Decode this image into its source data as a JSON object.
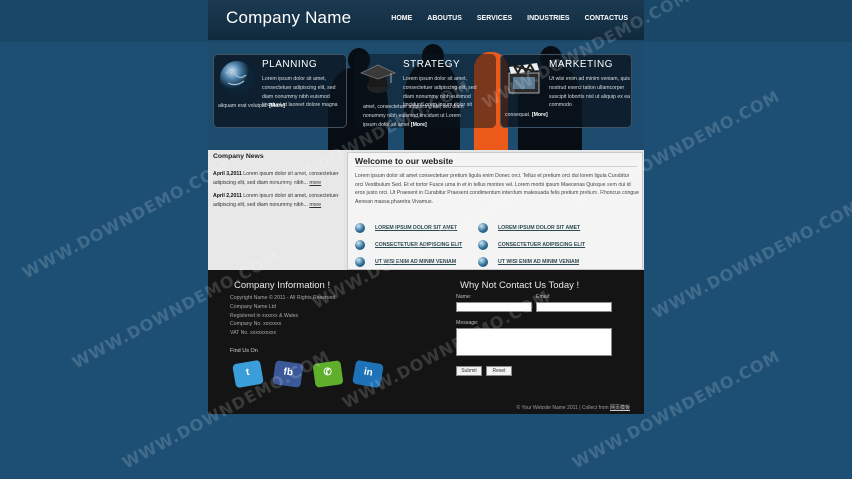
{
  "header": {
    "logo": "Company Name",
    "nav": [
      "HOME",
      "ABOUTUS",
      "SERVICES",
      "INDUSTRIES",
      "CONTACTUS"
    ]
  },
  "features": [
    {
      "title": "PLANNING",
      "icon": "globe-icon",
      "text": "Lorem ipsum dolor sit amet, consectetuer adipiscing elit, sed diam nonummy nibh euismod tincidunt ut laoreet dolore magna",
      "text2": "aliquam erat volutpat.",
      "more": "[More]"
    },
    {
      "title": "STRATEGY",
      "icon": "graduation-cap-icon",
      "text": "Lorem ipsum dolor sit amet, consectetuer adipiscing elit, sed diam nonummy nibh euismod tinciduntLorem ipsum dolor sit",
      "text2": "amet, consectetuer adipiscing elit, sed diam nonummy nibh euismod tincidunt ut Lorem ipsum dolor sit amet",
      "more": "[More]"
    },
    {
      "title": "MARKETING",
      "icon": "clapperboard-icon",
      "text": "Ut wisi enim ad minim veniam, quis nostrud exerci tation ullamcorper suscipit lobortis nisl ut aliquip ex ea commodo",
      "text2": "consequat.",
      "more": "[More]"
    }
  ],
  "news": {
    "title": "Company News",
    "items": [
      {
        "date": "April 3,2011",
        "text": "Lorem ipsum dolor sit amet, consectetuer adipiscing elit, sed diam nonummy nibh...",
        "more": "more"
      },
      {
        "date": "April 2,2011",
        "text": "Lorem ipsum dolor sit amet, consectetuer adipiscing elit, sed diam nonummy nibh...",
        "more": "more"
      }
    ]
  },
  "welcome": {
    "title": "Welcome to our website",
    "text": "Lorem ipsum dolor sit amet consectetuer pretium ligula enim Donec orci. Tellus et pretium orci dui lorem ligula Curabitur orci Vestibulum Sed. Et et tortor Fusce urna in et in tellus montes vel. Lorem morbi ipsum Maecenas Quisque sem dui id eros justo orci. Ut Praesent in Curabitur Praesent condimentum interdum malesuada felis pretium pretium. Rhoncus congue Aenean massa pharetra Vivamus.",
    "links": [
      "LOREM IPSUM DOLOR SIT AMET",
      "LOREM IPSUM DOLOR SIT AMET",
      "CONSECTETUER ADIPISCING ELIT",
      "CONSECTETUER ADIPISCING ELIT",
      "UT WISI ENIM AD MINIM VENIAM",
      "UT WISI ENIM AD MINIM VENIAM"
    ]
  },
  "footer": {
    "info_title": "Company Information !",
    "info_lines": [
      "Copyright Name © 2011 - All Rights Reserved",
      "Company Name Ltd",
      "Registered in xxxxxx & Wales",
      "Company No. xxxxxxx",
      "VAT No. xxxxxxxxxx"
    ],
    "find_us": "Find Us On",
    "social": [
      {
        "name": "twitter",
        "glyph": "t",
        "color": "#3a9fd8"
      },
      {
        "name": "facebook",
        "glyph": "fb",
        "color": "#3b5998"
      },
      {
        "name": "phone",
        "glyph": "✆",
        "color": "#5fae2c"
      },
      {
        "name": "linkedin",
        "glyph": "in",
        "color": "#1e73b8"
      }
    ],
    "contact_title": "Why Not Contact Us Today !",
    "name_label": "Name:",
    "email_label": "Email:",
    "message_label": "Message:",
    "submit": "Submit",
    "reset": "Reset",
    "copyright": "© Your Website Name 2011 | Collect from",
    "copyright_link": "网页模板"
  },
  "watermark": "WWW.DOWNDEMO.COM"
}
